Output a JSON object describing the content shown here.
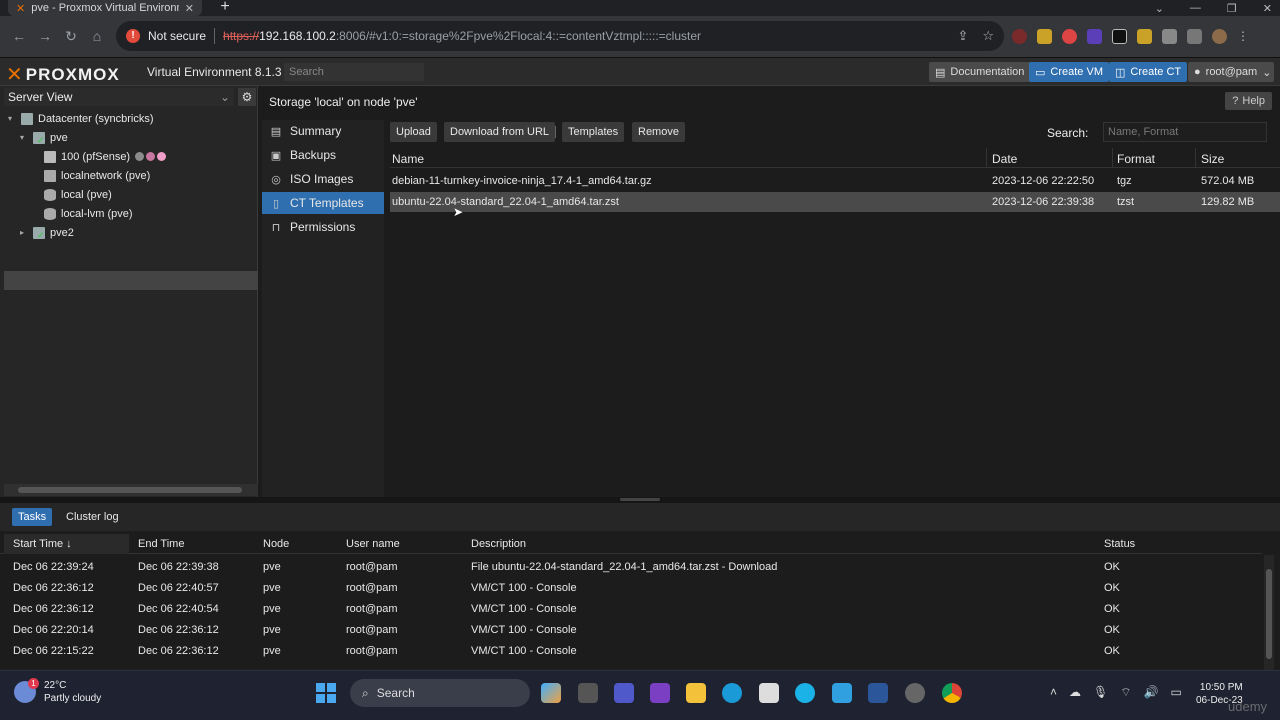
{
  "browser": {
    "tab_title": "pve - Proxmox Virtual Environment",
    "not_secure": "Not secure",
    "url_scheme": "https://",
    "url_host": "192.168.100.2",
    "url_rest": ":8006/#v1:0:=storage%2Fpve%2Flocal:4::=contentVztmpl:::::=cluster"
  },
  "header": {
    "logo": "PROXMOX",
    "version": "Virtual Environment 8.1.3",
    "search_placeholder": "Search",
    "documentation": "Documentation",
    "create_vm": "Create VM",
    "create_ct": "Create CT",
    "user": "root@pam"
  },
  "tree": {
    "view": "Server View",
    "datacenter": "Datacenter (syncbricks)",
    "node1": "pve",
    "vm100": "100 (pfSense)",
    "localnetwork": "localnetwork (pve)",
    "local": "local (pve)",
    "locallvm": "local-lvm (pve)",
    "node2": "pve2",
    "tag_colors": [
      "#8c8c8c",
      "#c878a0",
      "#f0a0c8"
    ]
  },
  "content": {
    "title": "Storage 'local' on node 'pve'",
    "help": "Help",
    "nav": [
      "Summary",
      "Backups",
      "ISO Images",
      "CT Templates",
      "Permissions"
    ],
    "active_nav": "CT Templates",
    "toolbar": {
      "upload": "Upload",
      "download_url": "Download from URL",
      "templates": "Templates",
      "remove": "Remove",
      "search_label": "Search:",
      "search_placeholder": "Name, Format"
    },
    "columns": {
      "name": "Name",
      "date": "Date",
      "format": "Format",
      "size": "Size"
    },
    "rows": [
      {
        "name": "debian-11-turnkey-invoice-ninja_17.4-1_amd64.tar.gz",
        "date": "2023-12-06 22:22:50",
        "format": "tgz",
        "size": "572.04 MB"
      },
      {
        "name": "ubuntu-22.04-standard_22.04-1_amd64.tar.zst",
        "date": "2023-12-06 22:39:38",
        "format": "tzst",
        "size": "129.82 MB"
      }
    ]
  },
  "tasks": {
    "tab_tasks": "Tasks",
    "tab_cluster_log": "Cluster log",
    "columns": {
      "start": "Start Time ↓",
      "end": "End Time",
      "node": "Node",
      "user": "User name",
      "desc": "Description",
      "status": "Status"
    },
    "rows": [
      {
        "start": "Dec 06 22:39:24",
        "end": "Dec 06 22:39:38",
        "node": "pve",
        "user": "root@pam",
        "desc": "File ubuntu-22.04-standard_22.04-1_amd64.tar.zst - Download",
        "status": "OK"
      },
      {
        "start": "Dec 06 22:36:12",
        "end": "Dec 06 22:40:57",
        "node": "pve",
        "user": "root@pam",
        "desc": "VM/CT 100 - Console",
        "status": "OK"
      },
      {
        "start": "Dec 06 22:36:12",
        "end": "Dec 06 22:40:54",
        "node": "pve",
        "user": "root@pam",
        "desc": "VM/CT 100 - Console",
        "status": "OK"
      },
      {
        "start": "Dec 06 22:20:14",
        "end": "Dec 06 22:36:12",
        "node": "pve",
        "user": "root@pam",
        "desc": "VM/CT 100 - Console",
        "status": "OK"
      },
      {
        "start": "Dec 06 22:15:22",
        "end": "Dec 06 22:36:12",
        "node": "pve",
        "user": "root@pam",
        "desc": "VM/CT 100 - Console",
        "status": "OK"
      }
    ]
  },
  "taskbar": {
    "temp": "22°C",
    "weather": "Partly cloudy",
    "search": "Search",
    "time": "10:50 PM",
    "date": "06-Dec-23",
    "watermark": "udemy"
  }
}
